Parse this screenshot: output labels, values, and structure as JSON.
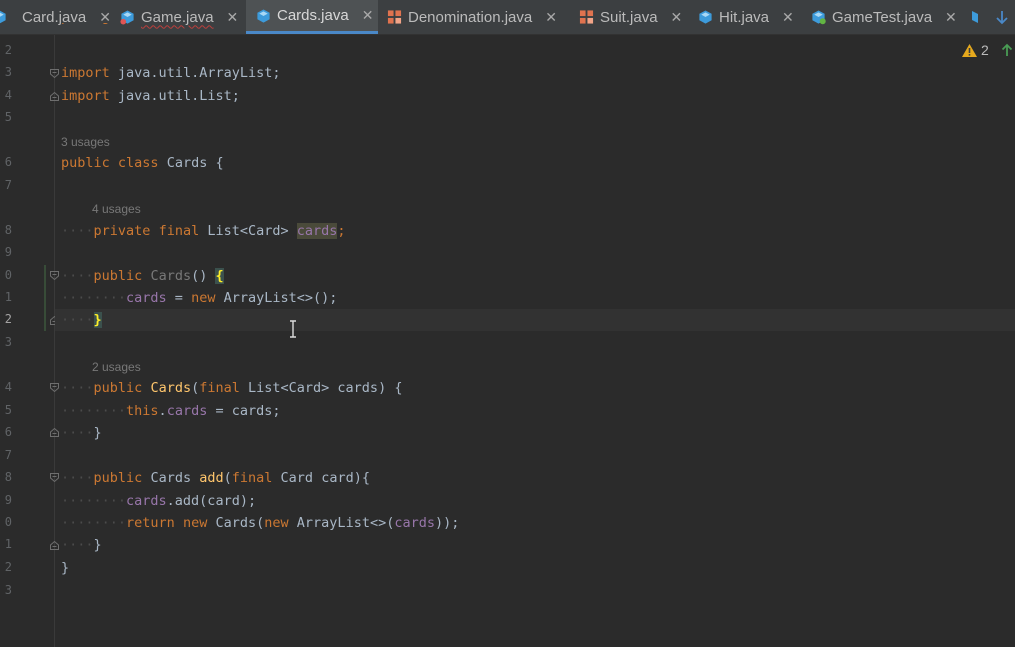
{
  "tabs": [
    {
      "label": "Card.java",
      "icon": "java-class-icon",
      "error": false,
      "active": false
    },
    {
      "label": "Game.java",
      "icon": "java-class-icon",
      "error": true,
      "active": false
    },
    {
      "label": "Cards.java",
      "icon": "java-class-icon",
      "error": false,
      "active": true
    },
    {
      "label": "Denomination.java",
      "icon": "java-enum-icon",
      "error": false,
      "active": false
    },
    {
      "label": "Suit.java",
      "icon": "java-enum-icon",
      "error": false,
      "active": false
    },
    {
      "label": "Hit.java",
      "icon": "java-class-icon",
      "error": false,
      "active": false
    },
    {
      "label": "GameTest.java",
      "icon": "java-test-class-icon",
      "error": false,
      "active": false
    }
  ],
  "inspection": {
    "warning_count": "2",
    "icon": "warning-icon"
  },
  "gutter": {
    "line_numbers": [
      "2",
      "3",
      "4",
      "5",
      "",
      "6",
      "7",
      "",
      "8",
      "9",
      "0",
      "1",
      "2",
      "3",
      "",
      "4",
      "5",
      "6",
      "7",
      "8",
      "9",
      "0",
      "1",
      "2",
      "3"
    ]
  },
  "code": {
    "import1": {
      "kw": "import",
      "path": "java.util.ArrayList;"
    },
    "import2": {
      "kw": "import",
      "path": "java.util.List;"
    },
    "usages_class": "3 usages",
    "class_decl": {
      "kw1": "public",
      "kw2": "class",
      "name": "Cards",
      "brace": "{"
    },
    "usages_field": "4 usages",
    "field_decl": {
      "kw1": "private",
      "kw2": "final",
      "type": "List<Card>",
      "name": "cards",
      "end": ";"
    },
    "ctor1": {
      "kw": "public",
      "name": "Cards",
      "parens": "()",
      "brace": "{"
    },
    "ctor1_body": {
      "field": "cards",
      "eq": " = ",
      "kw": "new",
      "rest": "ArrayList<>();"
    },
    "ctor1_close": "}",
    "usages_ctor2": "2 usages",
    "ctor2": {
      "kw": "public",
      "name": "Cards",
      "open": "(",
      "kw2": "final",
      "type": "List<Card>",
      "param": "cards",
      "close": ") {"
    },
    "ctor2_body": {
      "kw": "this",
      "dot": ".",
      "field": "cards",
      "rest": " = cards;"
    },
    "ctor2_close": "}",
    "add_decl": {
      "kw": "public",
      "type": "Cards",
      "name": "add",
      "open": "(",
      "kw2": "final",
      "ptype": "Card",
      "param": "card",
      "close": "){"
    },
    "add_body1": {
      "field": "cards",
      "rest": ".add(card);"
    },
    "add_body2": {
      "kw": "return",
      "kw2": "new",
      "type": "Cards(",
      "kw3": "new",
      "type2": "ArrayList<>(",
      "field": "cards",
      "end": "));"
    },
    "add_close": "}",
    "class_close": "}"
  },
  "colors": {
    "background": "#2b2b2b",
    "keyword": "#cc7832",
    "field": "#9876aa",
    "method": "#ffc66d",
    "text": "#a9b7c6",
    "accent": "#4a88c7"
  }
}
